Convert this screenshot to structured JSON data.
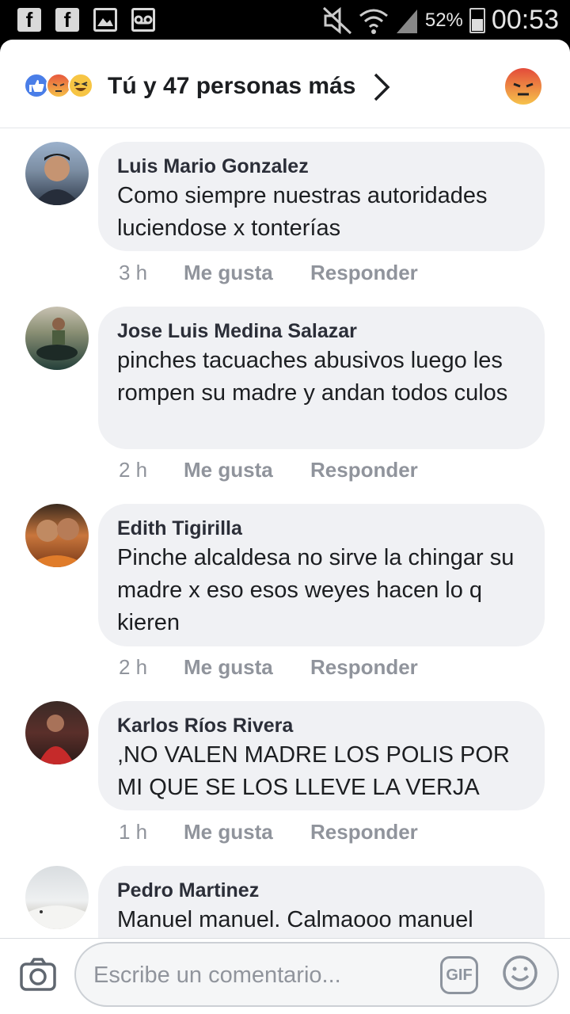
{
  "status_bar": {
    "notification_icons": [
      "facebook-icon",
      "facebook-icon",
      "gallery-icon",
      "voicemail-icon"
    ],
    "battery": "52%",
    "time": "00:53"
  },
  "reactions": {
    "icons": [
      "like",
      "angry",
      "haha"
    ],
    "summary": "Tú y 47 personas más",
    "selected_reaction": "angry"
  },
  "comments": [
    {
      "author": "Luis Mario Gonzalez",
      "text": "Como siempre nuestras autoridades luciendose x tonterías",
      "time": "3 h",
      "like_label": "Me gusta",
      "reply_label": "Responder"
    },
    {
      "author": "Jose Luis Medina Salazar",
      "text": "pinches tacuaches abusivos luego les rompen su madre y andan todos culos",
      "time": "2 h",
      "like_label": "Me gusta",
      "reply_label": "Responder"
    },
    {
      "author": "Edith Tigirilla",
      "text": "Pinche alcaldesa no sirve la chingar su madre x eso esos weyes hacen lo q kieren",
      "time": "2 h",
      "like_label": "Me gusta",
      "reply_label": "Responder"
    },
    {
      "author": "Karlos Ríos Rivera",
      "text": ",NO VALEN MADRE LOS POLIS POR MI QUE SE LOS LLEVE LA VERJA",
      "time": "1 h",
      "like_label": "Me gusta",
      "reply_label": "Responder"
    },
    {
      "author": "Pedro Martinez",
      "text": "Manuel manuel. Calmaooo manuel",
      "time": "",
      "like_label": "",
      "reply_label": ""
    }
  ],
  "composer": {
    "placeholder": "Escribe un comentario...",
    "gif_label": "GIF"
  },
  "colors": {
    "bubble": "#f0f1f4",
    "meta_text": "#90949c",
    "like_blue": "#4a7ee8",
    "angry_red": "#e34b3a"
  }
}
